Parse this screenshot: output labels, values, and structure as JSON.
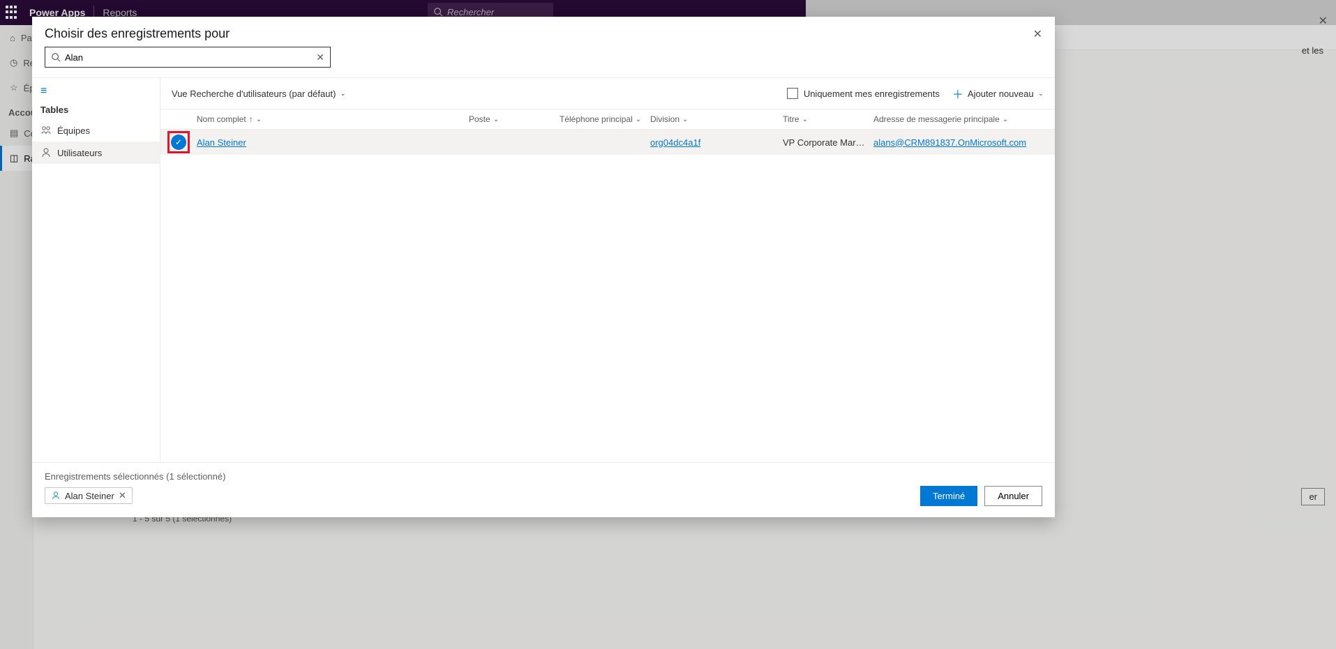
{
  "bg": {
    "app_name": "Power Apps",
    "section": "Reports",
    "search_placeholder": "Rechercher",
    "nav_items": [
      "Pa",
      "Ré",
      "Ép",
      "",
      "Cé",
      "Ra"
    ],
    "accounts_label": "Accour",
    "range_text": "1 - 5 sur 5 (1 sélectionnés)",
    "trailing_text": "et les",
    "outline_btn": "er"
  },
  "modal": {
    "title": "Choisir des enregistrements pour",
    "search_value": "Alan",
    "tables_header": "Tables",
    "table_items": [
      {
        "label": "Équipes",
        "selected": false
      },
      {
        "label": "Utilisateurs",
        "selected": true
      }
    ],
    "view_selector": "Vue Recherche d'utilisateurs (par défaut)",
    "only_mine": "Uniquement mes enregistrements",
    "add_new": "Ajouter nouveau",
    "columns": {
      "name": "Nom complet",
      "poste": "Poste",
      "phone": "Téléphone principal",
      "division": "Division",
      "title": "Titre",
      "email": "Adresse de messagerie principale"
    },
    "rows": [
      {
        "selected": true,
        "name": "Alan Steiner",
        "poste": "",
        "phone": "",
        "division": "org04dc4a1f",
        "title": "VP Corporate Mar…",
        "email": "alans@CRM891837.OnMicrosoft.com"
      }
    ],
    "selected_label": "Enregistrements sélectionnés (1 sélectionné)",
    "selected_chip": "Alan Steiner",
    "done": "Terminé",
    "cancel": "Annuler"
  }
}
